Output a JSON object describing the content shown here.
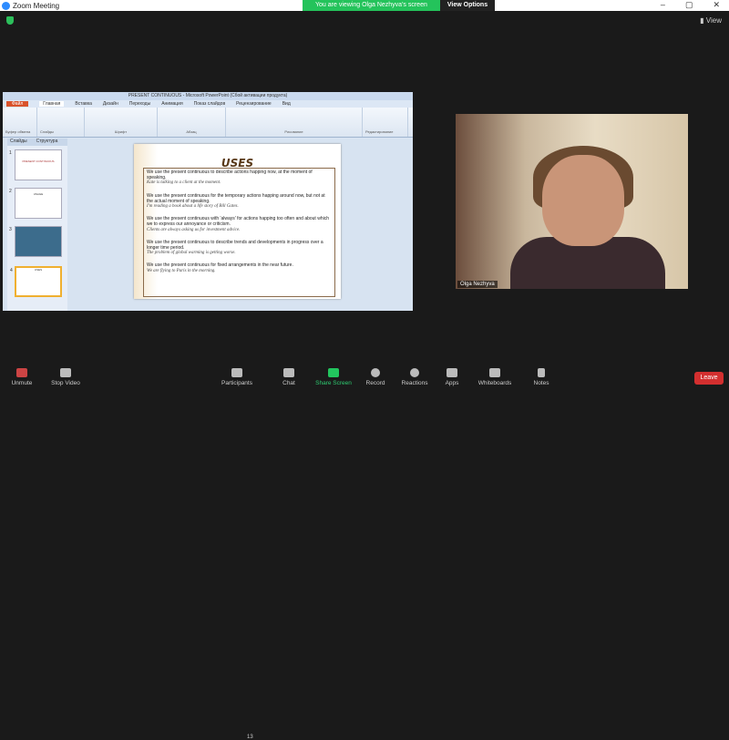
{
  "window": {
    "title": "Zoom Meeting",
    "banner": "You are viewing Olga Nezhyva's screen",
    "view_options": "View Options",
    "view": "View"
  },
  "ppt": {
    "title": "PRESENT CONTINUOUS - Microsoft PowerPoint (Сбой активации продукта)",
    "tabs": [
      "Файл",
      "Главная",
      "Вставка",
      "Дизайн",
      "Переходы",
      "Анимация",
      "Показ слайдов",
      "Рецензирование",
      "Вид"
    ],
    "groups": [
      "Буфер обмена",
      "Слайды",
      "Шрифт",
      "Абзац",
      "Рисование",
      "Редактирование"
    ],
    "panel_tabs": [
      "Слайды",
      "Структура"
    ],
    "thumbs": [
      {
        "n": "1",
        "t": "PRESENT CONTINUOUS"
      },
      {
        "n": "2",
        "t": "USAGE"
      },
      {
        "n": "3",
        "t": ""
      },
      {
        "n": "4",
        "t": "USES"
      }
    ],
    "slide": {
      "title": "USES",
      "items": [
        {
          "rule": "We use the present continuous to describe actions happing now, at the moment of speaking.",
          "example": "Kate is talking to a client at the moment."
        },
        {
          "rule": "We use the present continuous for the temporary actions happing around now, but not at the actual moment of speaking.",
          "example": "I'm reading a book about a life story of Bill Gates."
        },
        {
          "rule": "We use the present continuous with 'always' for actions happing too often and about which we to express our annoyance or criticism.",
          "example": "Clients are always asking us for investment advice."
        },
        {
          "rule": "We use the present continuous to describe trends and developments in progress over a longer time period.",
          "example": "The problem of global warming is getting worse."
        },
        {
          "rule": "We use the present continuous for fixed arrangements in the near future.",
          "example": "We are flying to Paris in the morning."
        }
      ]
    }
  },
  "video": {
    "name": "Olga Nezhyva"
  },
  "toolbar": {
    "unmute": "Unmute",
    "stop_video": "Stop Video",
    "participants": "Participants",
    "participants_count": "13",
    "chat": "Chat",
    "share": "Share Screen",
    "record": "Record",
    "reactions": "Reactions",
    "apps": "Apps",
    "whiteboards": "Whiteboards",
    "notes": "Notes",
    "leave": "Leave"
  }
}
